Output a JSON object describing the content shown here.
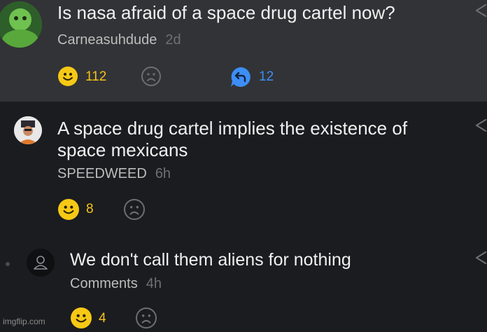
{
  "post": {
    "title": "Is nasa afraid of a space drug cartel now?",
    "author": "Carneasuhdude",
    "time": "2d",
    "upvotes": "112",
    "replies": "12"
  },
  "comments": [
    {
      "text_line1": "A space drug cartel implies the existence of",
      "text_line2": "space mexicans",
      "author": "SPEEDWEED",
      "time": "6h",
      "upvotes": "8"
    },
    {
      "text": "We don't call them aliens for nothing",
      "author": "Comments",
      "time": "4h",
      "upvotes": "4"
    }
  ],
  "watermark": "imgflip.com",
  "colors": {
    "background": "#1b1c1f",
    "post_background": "#323336",
    "upvote": "#f7c916",
    "reply": "#3d8ef7"
  },
  "icons": [
    "smile-upvote-icon",
    "frown-downvote-icon",
    "reply-bubble-icon",
    "share-icon",
    "user-placeholder-icon"
  ]
}
